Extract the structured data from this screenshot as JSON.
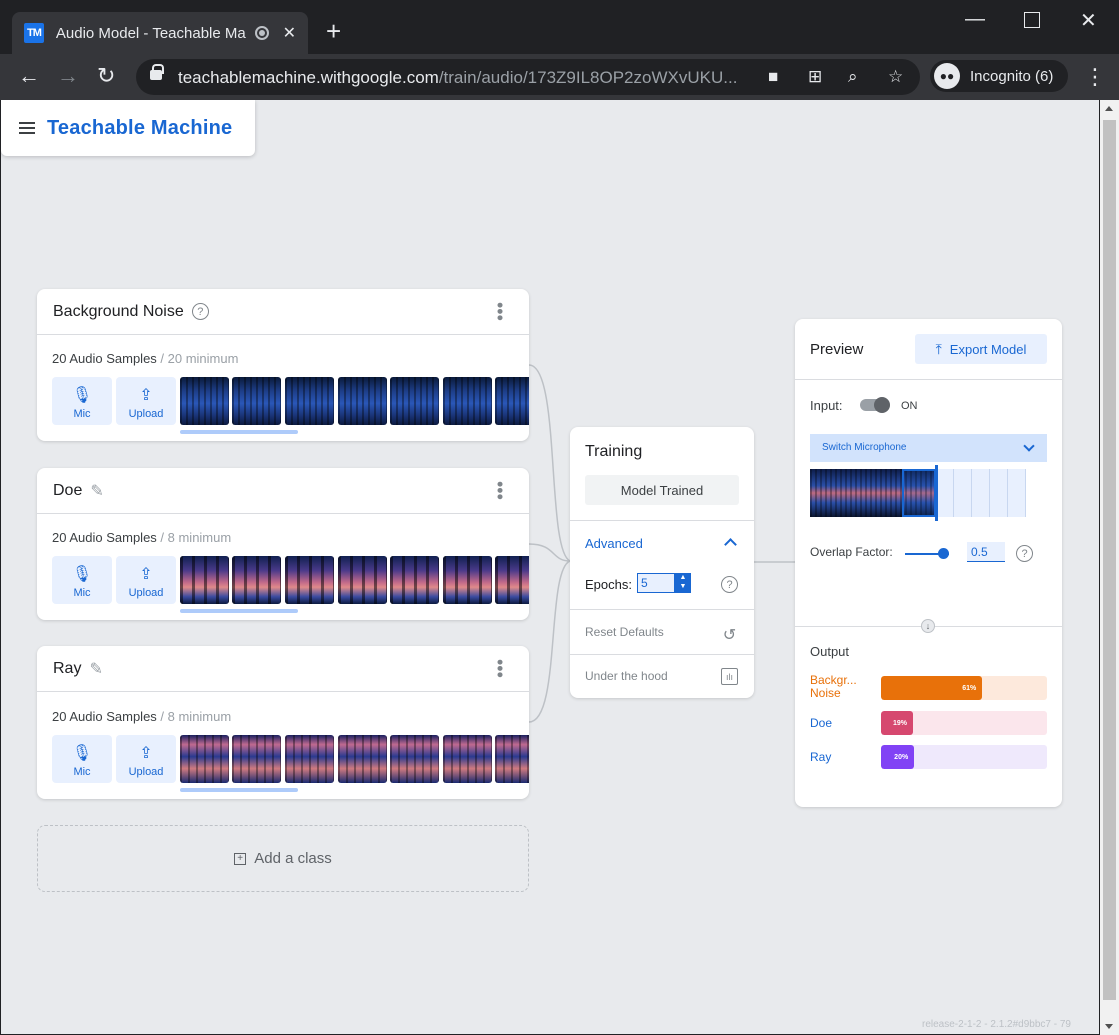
{
  "browser": {
    "tab_title": "Audio Model - Teachable Ma",
    "tab_favicon": "TM",
    "url_host": "teachablemachine.withgoogle.com",
    "url_path": "/train/audio/173Z9IL8OP2zoWXvUKU...",
    "profile_label": "Incognito (6)"
  },
  "app": {
    "brand": "Teachable Machine"
  },
  "classes": [
    {
      "name": "Background Noise",
      "samples": "20 Audio Samples",
      "minimum": " / 20 minimum"
    },
    {
      "name": "Doe",
      "samples": "20 Audio Samples",
      "minimum": " / 8 minimum"
    },
    {
      "name": "Ray",
      "samples": "20 Audio Samples",
      "minimum": " / 8 minimum"
    }
  ],
  "sample_buttons": {
    "mic": "Mic",
    "upload": "Upload"
  },
  "add_class": "Add a class",
  "training": {
    "title": "Training",
    "status_button": "Model Trained",
    "advanced": "Advanced",
    "epochs_label": "Epochs:",
    "epochs_value": "5",
    "reset_defaults": "Reset Defaults",
    "under_the_hood": "Under the hood"
  },
  "preview": {
    "title": "Preview",
    "export_button": "Export Model",
    "input_label": "Input:",
    "toggle_state": "ON",
    "microphone_select": "Switch Microphone",
    "overlap_label": "Overlap Factor:",
    "overlap_value": "0.5",
    "output_title": "Output",
    "outputs": [
      {
        "label": "Backgr... Noise",
        "percent": "61%",
        "value": 61,
        "color": "#e8710a",
        "track": "#fde9dc",
        "text_color": "#e8710a"
      },
      {
        "label": "Doe",
        "percent": "19%",
        "value": 19,
        "color": "#d6486f",
        "track": "#fbe6ec",
        "text_color": "#1967d2"
      },
      {
        "label": "Ray",
        "percent": "20%",
        "value": 20,
        "color": "#8142f5",
        "track": "#efe9fc",
        "text_color": "#1967d2"
      }
    ]
  },
  "footer": {
    "version": "release-2-1-2 - 2.1.2#d9bbc7 - 79"
  }
}
